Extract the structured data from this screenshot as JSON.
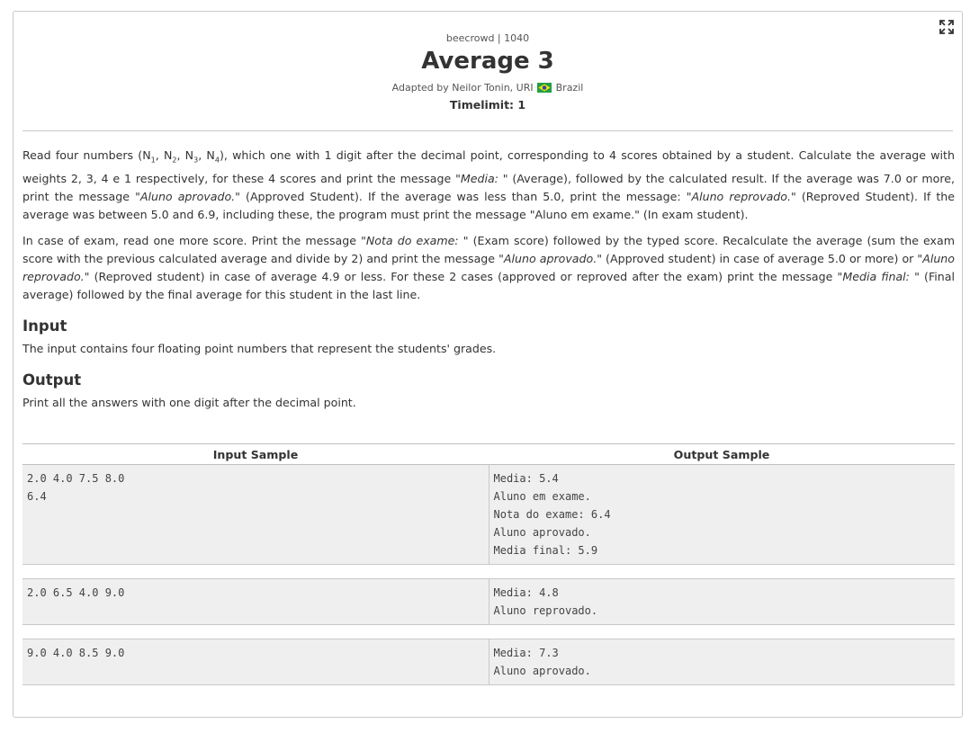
{
  "header": {
    "meta": "beecrowd | 1040",
    "title": "Average 3",
    "adapted_prefix": "Adapted by Neilor Tonin, URI",
    "country": "Brazil",
    "timelimit": "Timelimit: 1",
    "expand_icon": "expand-icon",
    "flag_icon": "brazil-flag-icon"
  },
  "description": {
    "p1": [
      {
        "t": "Read four numbers (N"
      },
      {
        "sub": "1"
      },
      {
        "t": ", N"
      },
      {
        "sub": "2"
      },
      {
        "t": ", N"
      },
      {
        "sub": "3"
      },
      {
        "t": ", N"
      },
      {
        "sub": "4"
      },
      {
        "t": "), which one with 1 digit after the decimal point, corresponding to 4 scores obtained by a student. Calculate the average with weights 2, 3, 4 e 1 respectively, for these 4 scores and print the message "
      },
      {
        "em": "\"Media: \""
      },
      {
        "t": " (Average), followed by the calculated result. If the average was 7.0 or more, print the message "
      },
      {
        "em": "\"Aluno aprovado.\""
      },
      {
        "t": " (Approved Student). If the average was less than 5.0, print the message: "
      },
      {
        "em": "\"Aluno reprovado.\""
      },
      {
        "t": " (Reproved Student). If the average was between 5.0 and 6.9, including these, the program must print the message \"Aluno em exame.\" (In exam student)."
      }
    ],
    "p2": [
      {
        "t": "In case of exam, read one more score. Print the message "
      },
      {
        "em": "\"Nota do exame: \""
      },
      {
        "t": " (Exam score) followed by the typed score. Recalculate the average (sum the exam score with the previous calculated average and divide by 2) and print the message "
      },
      {
        "em": "\"Aluno aprovado.\""
      },
      {
        "t": " (Approved student) in case of average 5.0 or more) or "
      },
      {
        "em": "\"Aluno reprovado.\""
      },
      {
        "t": " (Reproved student) in case of average 4.9 or less. For these 2 cases (approved or reproved after the exam) print the message "
      },
      {
        "em": "\"Media final: \""
      },
      {
        "t": " (Final average) followed by the final average for this student in the last line."
      }
    ]
  },
  "input_section": {
    "heading": "Input",
    "text": "The input contains four floating point numbers that represent the students' grades."
  },
  "output_section": {
    "heading": "Output",
    "text": "Print all the answers with one digit after the decimal point."
  },
  "samples": {
    "input_header": "Input Sample",
    "output_header": "Output Sample",
    "cases": [
      {
        "input": [
          "2.0 4.0 7.5 8.0",
          "6.4"
        ],
        "output": [
          "Media: 5.4",
          "Aluno em exame.",
          "Nota do exame: 6.4",
          "Aluno aprovado.",
          "Media final: 5.9"
        ]
      },
      {
        "input": [
          "2.0 6.5 4.0 9.0"
        ],
        "output": [
          "Media: 4.8",
          "Aluno reprovado."
        ]
      },
      {
        "input": [
          "9.0 4.0 8.5 9.0"
        ],
        "output": [
          "Media: 7.3",
          "Aluno aprovado."
        ]
      }
    ]
  }
}
